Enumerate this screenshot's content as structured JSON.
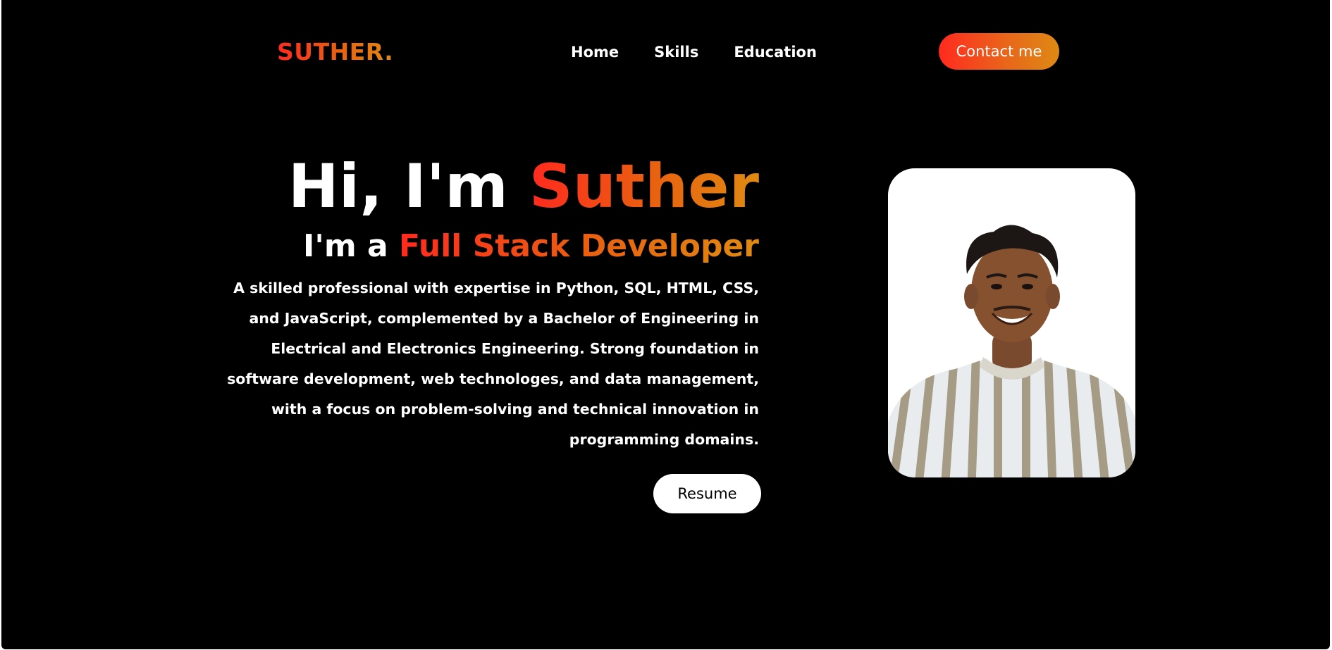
{
  "header": {
    "logo": "SUTHER.",
    "nav": {
      "home": "Home",
      "skills": "Skills",
      "education": "Education"
    },
    "contact_label": "Contact me"
  },
  "hero": {
    "greeting": "Hi, I'm ",
    "name": "Suther",
    "role_prefix": "I'm a ",
    "role": "Full Stack Developer",
    "description": "A skilled professional with expertise in Python, SQL, HTML, CSS, and JavaScript, complemented by a Bachelor of Engineering in Electrical and Electronics Engineering. Strong foundation in software development, web technologes, and data management, with a focus on problem-solving and technical innovation in programming domains.",
    "resume_label": "Resume"
  },
  "colors": {
    "background": "#000000",
    "accent_start": "#ff2a1f",
    "accent_end": "#e08a12",
    "text": "#ffffff"
  }
}
